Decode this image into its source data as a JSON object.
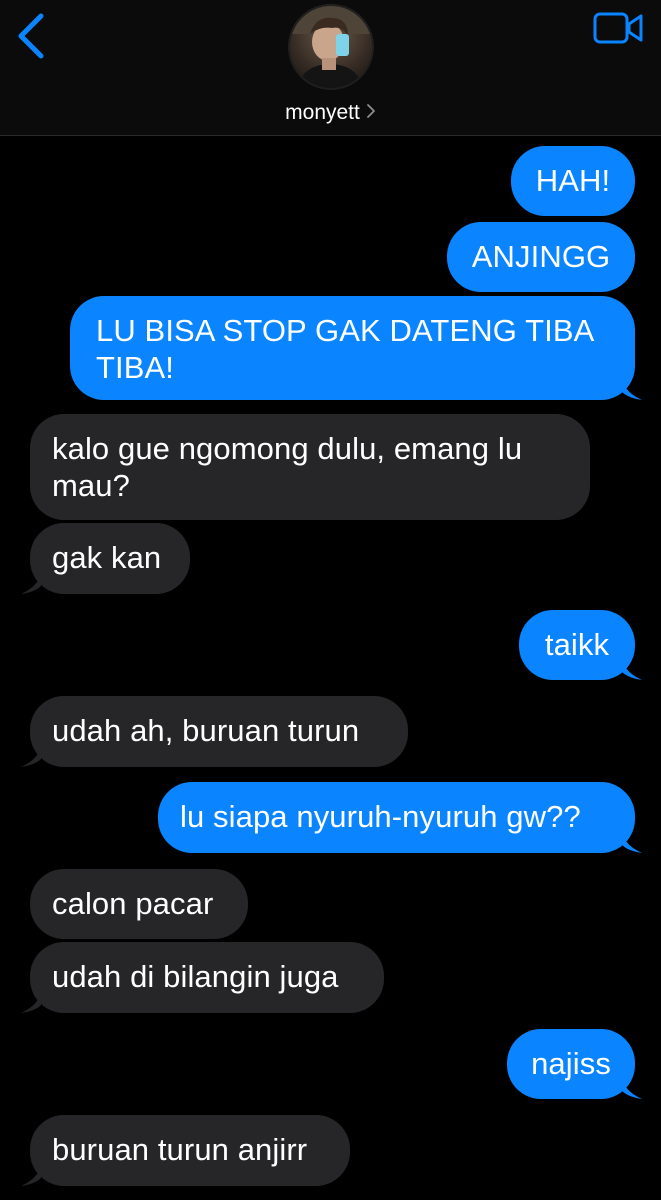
{
  "header": {
    "contact_name": "monyett",
    "back_icon": "chevron-left-icon",
    "video_icon": "video-camera-icon",
    "accent_color": "#0a84ff"
  },
  "colors": {
    "outgoing_bubble": "#0a84ff",
    "incoming_bubble": "#262628",
    "background": "#000000"
  },
  "messages": [
    {
      "direction": "outgoing",
      "text": "HAH!"
    },
    {
      "direction": "outgoing",
      "text": "ANJINGG"
    },
    {
      "direction": "outgoing",
      "text": "LU BISA STOP GAK DATENG TIBA TIBA!"
    },
    {
      "direction": "incoming",
      "text": "kalo gue ngomong dulu, emang lu mau?"
    },
    {
      "direction": "incoming",
      "text": "gak kan"
    },
    {
      "direction": "outgoing",
      "text": "taikk"
    },
    {
      "direction": "incoming",
      "text": "udah ah, buruan turun"
    },
    {
      "direction": "outgoing",
      "text": "lu siapa nyuruh-nyuruh gw??"
    },
    {
      "direction": "incoming",
      "text": "calon pacar"
    },
    {
      "direction": "incoming",
      "text": "udah di bilangin juga"
    },
    {
      "direction": "outgoing",
      "text": "najiss"
    },
    {
      "direction": "incoming",
      "text": "buruan turun anjirr"
    }
  ]
}
